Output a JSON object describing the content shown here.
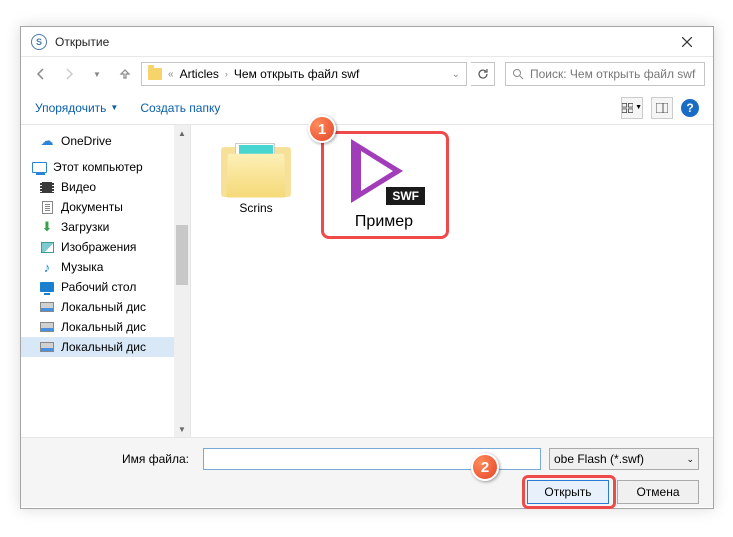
{
  "titlebar": {
    "title": "Открытие"
  },
  "breadcrumb": {
    "parts": [
      "Articles",
      "Чем открыть файл swf"
    ]
  },
  "search": {
    "placeholder": "Поиск: Чем открыть файл swf"
  },
  "toolbar": {
    "organize": "Упорядочить",
    "new_folder": "Создать папку",
    "help": "?"
  },
  "sidebar": {
    "items": [
      {
        "label": "OneDrive",
        "icon": "cloud"
      },
      {
        "label": "Этот компьютер",
        "icon": "pc"
      },
      {
        "label": "Видео",
        "icon": "film"
      },
      {
        "label": "Документы",
        "icon": "doc"
      },
      {
        "label": "Загрузки",
        "icon": "download"
      },
      {
        "label": "Изображения",
        "icon": "image"
      },
      {
        "label": "Музыка",
        "icon": "music"
      },
      {
        "label": "Рабочий стол",
        "icon": "desktop"
      },
      {
        "label": "Локальный дис",
        "icon": "disk"
      },
      {
        "label": "Локальный дис",
        "icon": "disk"
      },
      {
        "label": "Локальный дис",
        "icon": "disk"
      }
    ]
  },
  "content": {
    "folder_name": "Scrins",
    "swf_name": "Пример",
    "swf_badge": "SWF"
  },
  "footer": {
    "filename_label": "Имя файла:",
    "filename_value": "",
    "filetype": "obe Flash (*.swf)",
    "open": "Открыть",
    "cancel": "Отмена"
  },
  "markers": {
    "m1": "1",
    "m2": "2"
  }
}
